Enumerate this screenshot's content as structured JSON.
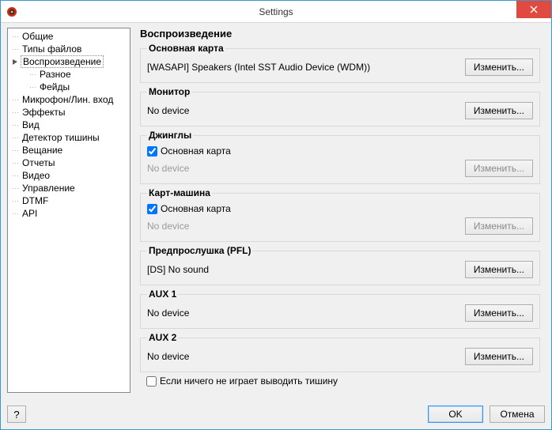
{
  "window": {
    "title": "Settings"
  },
  "tree": {
    "items": [
      {
        "label": "Общие"
      },
      {
        "label": "Типы файлов"
      },
      {
        "label": "Воспроизведение",
        "selected": true,
        "expanded": true,
        "children": [
          {
            "label": "Разное"
          },
          {
            "label": "Фейды"
          }
        ]
      },
      {
        "label": "Микрофон/Лин. вход"
      },
      {
        "label": "Эффекты"
      },
      {
        "label": "Вид"
      },
      {
        "label": "Детектор тишины"
      },
      {
        "label": "Вещание"
      },
      {
        "label": "Отчеты"
      },
      {
        "label": "Видео"
      },
      {
        "label": "Управление"
      },
      {
        "label": "DTMF"
      },
      {
        "label": "API"
      }
    ]
  },
  "page": {
    "title": "Воспроизведение",
    "change_label": "Изменить...",
    "sections": {
      "main_card": {
        "legend": "Основная карта",
        "device": "[WASAPI] Speakers (Intel SST Audio Device (WDM))"
      },
      "monitor": {
        "legend": "Монитор",
        "device": "No device"
      },
      "jingles": {
        "legend": "Джинглы",
        "use_main_label": "Основная карта",
        "use_main_checked": true,
        "device": "No device"
      },
      "cart": {
        "legend": "Карт-машина",
        "use_main_label": "Основная карта",
        "use_main_checked": true,
        "device": "No device"
      },
      "pfl": {
        "legend": "Предпрослушка (PFL)",
        "device": "[DS] No sound"
      },
      "aux1": {
        "legend": "AUX 1",
        "device": "No device"
      },
      "aux2": {
        "legend": "AUX 2",
        "device": "No device"
      }
    },
    "silence_checkbox": {
      "label": "Если ничего не играет выводить тишину",
      "checked": false
    }
  },
  "buttons": {
    "help": "?",
    "ok": "OK",
    "cancel": "Отмена"
  }
}
